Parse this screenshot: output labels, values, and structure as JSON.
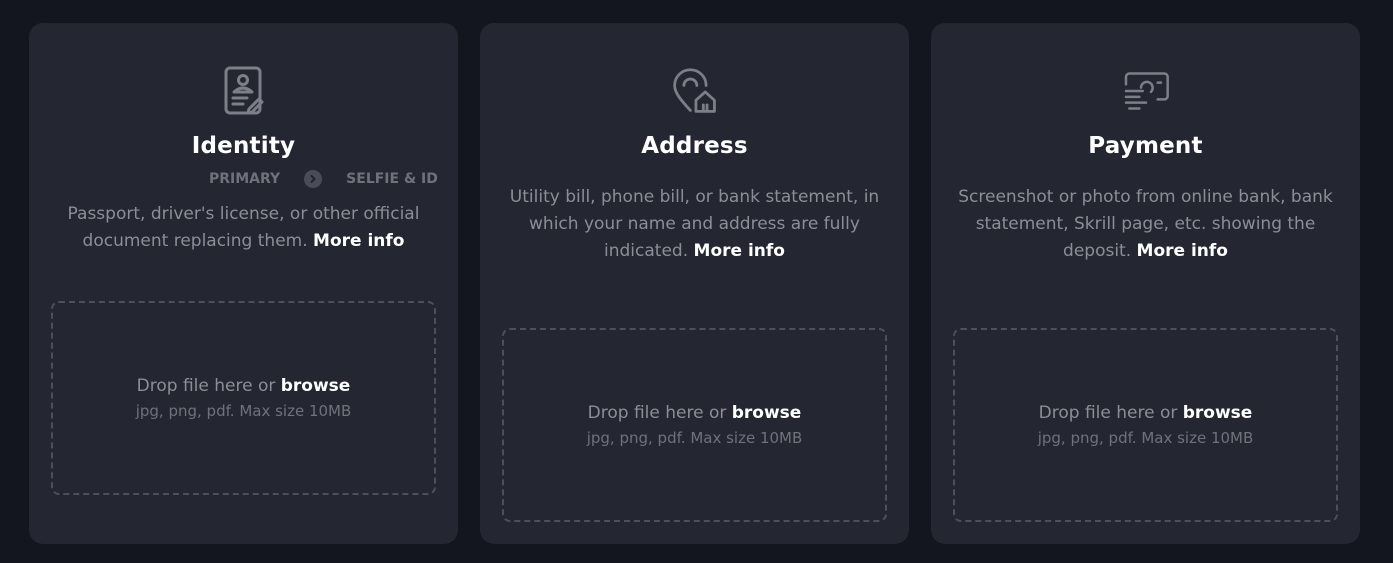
{
  "cards": [
    {
      "id": "identity",
      "icon": "id-document-icon",
      "title": "Identity",
      "steps": [
        "PRIMARY",
        "SELFIE & ID"
      ],
      "description": "Passport, driver's license, or other official document replacing them.",
      "more_info": "More info",
      "drop_text": "Drop file here or",
      "browse": "browse",
      "hint": "jpg, png, pdf. Max size 10MB"
    },
    {
      "id": "address",
      "icon": "location-home-icon",
      "title": "Address",
      "description": "Utility bill, phone bill, or bank statement, in which your name and address are fully indicated.",
      "more_info": "More info",
      "drop_text": "Drop file here or",
      "browse": "browse",
      "hint": "jpg, png, pdf. Max size 10MB"
    },
    {
      "id": "payment",
      "icon": "payment-bill-icon",
      "title": "Payment",
      "description": "Screenshot or photo from online bank, bank statement, Skrill page, etc. showing the deposit.",
      "more_info": "More info",
      "drop_text": "Drop file here or",
      "browse": "browse",
      "hint": "jpg, png, pdf. Max size 10MB"
    }
  ],
  "colors": {
    "page_bg": "#14161f",
    "card_bg": "#242631",
    "text_muted": "#8c8e97",
    "text_bright": "#ffffff",
    "icon": "#7d7f88"
  }
}
